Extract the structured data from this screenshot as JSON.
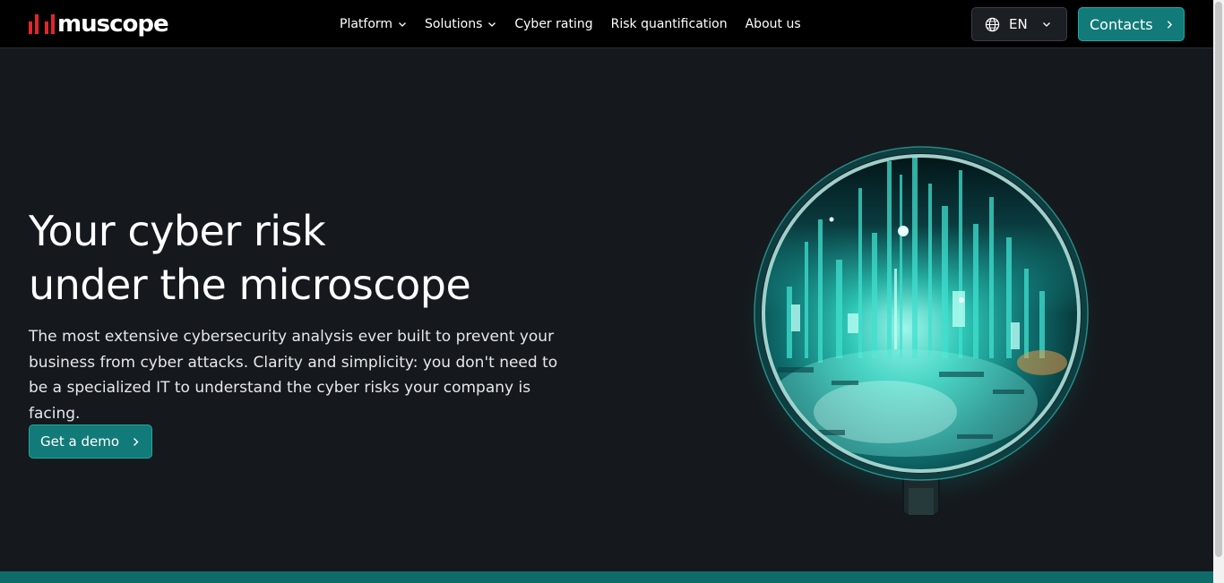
{
  "header": {
    "logo_text": "muscope",
    "nav": [
      {
        "label": "Platform",
        "has_dropdown": true
      },
      {
        "label": "Solutions",
        "has_dropdown": true
      },
      {
        "label": "Cyber rating",
        "has_dropdown": false
      },
      {
        "label": "Risk quantification",
        "has_dropdown": false
      },
      {
        "label": "About us",
        "has_dropdown": false
      }
    ],
    "language": {
      "label": "EN",
      "icon": "globe-icon"
    },
    "contacts_label": "Contacts"
  },
  "hero": {
    "title_line1": "Your cyber risk",
    "title_line2": "under the microscope",
    "description": "The most extensive cybersecurity analysis ever built to prevent your business from cyber attacks. Clarity and simplicity: you don't need to be a specialized IT to understand the cyber risks your company is facing.",
    "cta_label": "Get a demo"
  },
  "colors": {
    "accent": "#127a78",
    "accent_border": "#1fa9a3",
    "brand_red": "#e3262b",
    "background": "#15181c",
    "header_bg": "#000000"
  }
}
